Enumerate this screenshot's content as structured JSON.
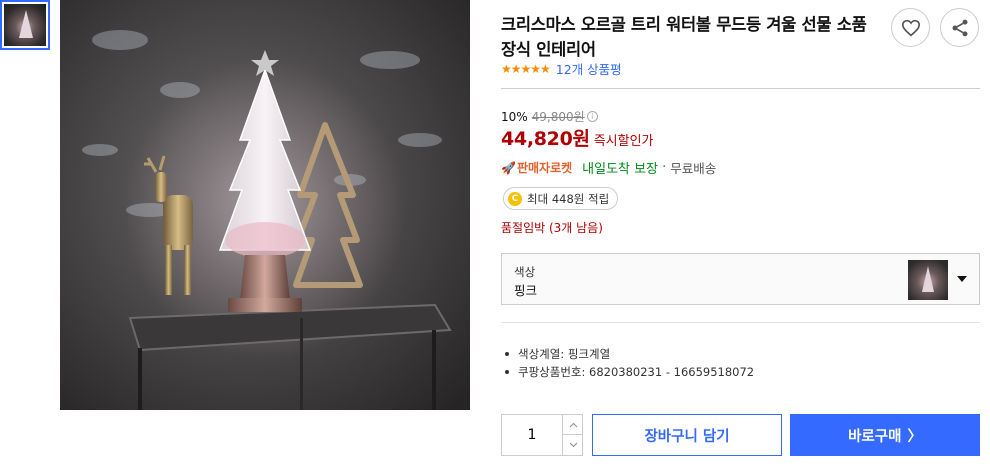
{
  "product": {
    "title": "크리스마스 오르골 트리 워터볼 무드등 겨울 선물 소품 장식 인테리어",
    "rating_stars": "★★★★★",
    "review_count": "12개 상품평"
  },
  "price": {
    "discount_rate": "10%",
    "original_price": "49,800원",
    "info_mark": "i",
    "sale_price": "44,820원",
    "sale_label": "즉시할인가"
  },
  "delivery": {
    "rocket_icon": "🚀",
    "badge": "판매자로켓",
    "arrival": "내일도착 보장",
    "separator": "·",
    "shipping": "무료배송"
  },
  "reward": {
    "coin_mark": "C",
    "text": "최대 448원 적립"
  },
  "stock_note": "품절임박 (3개 남음)",
  "option": {
    "label": "색상",
    "value": "핑크"
  },
  "attributes": [
    "색상계열: 핑크계열",
    "쿠팡상품번호: 6820380231 - 16659518072"
  ],
  "quantity": {
    "value": "1"
  },
  "buttons": {
    "cart": "장바구니 담기",
    "buy": "바로구매",
    "buy_arrow": "〉"
  },
  "icons": {
    "wish": "heart-icon",
    "share": "share-icon",
    "rocket": "rocket-icon",
    "coin": "coin-icon",
    "caret": "chevron-down-icon"
  },
  "colors": {
    "accent": "#346aff",
    "sale": "#ae0000",
    "arrival": "#00891a",
    "rocket": "#e4602c",
    "star": "#f58c06"
  }
}
